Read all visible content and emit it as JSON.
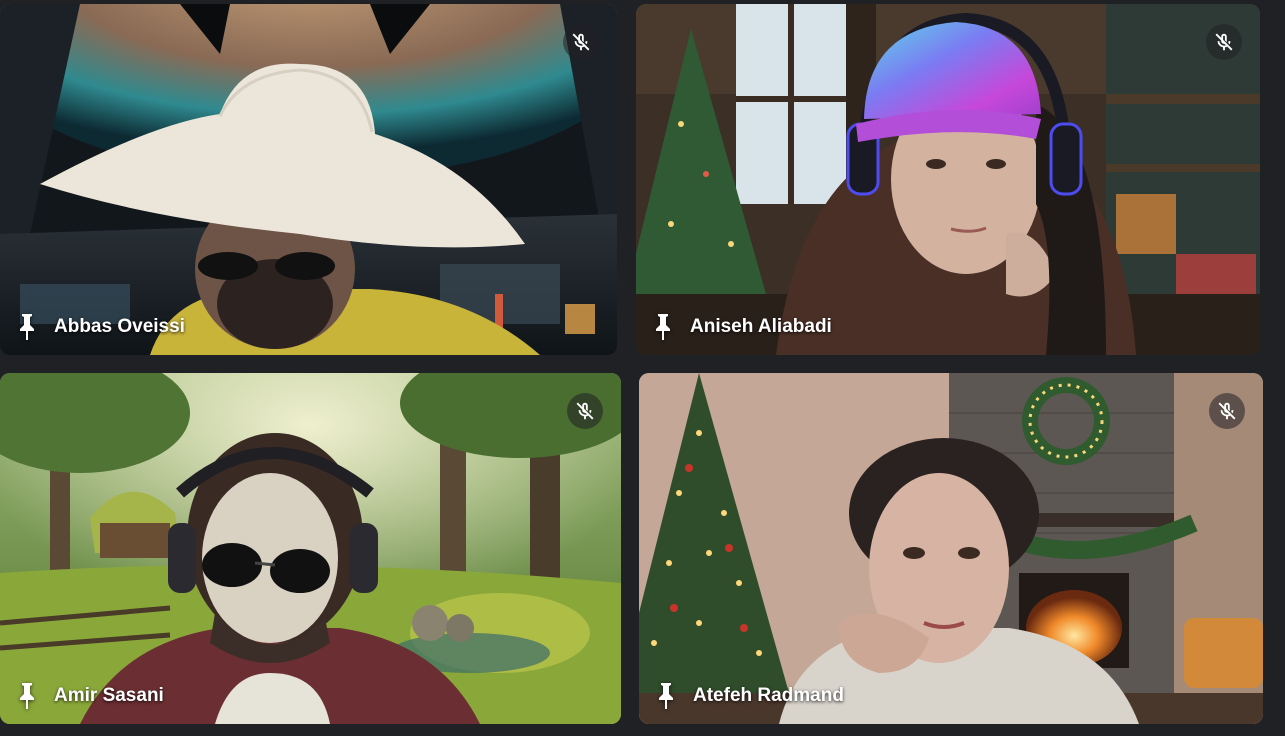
{
  "participants": [
    {
      "name": "Abbas Oveissi",
      "muted": true,
      "status_icon": "mic-off-icon",
      "pin_icon": "pin-icon"
    },
    {
      "name": "Aniseh Aliabadi",
      "muted": true,
      "status_icon": "mic-off-icon",
      "pin_icon": "pin-icon"
    },
    {
      "name": "Amir Sasani",
      "muted": true,
      "status_icon": "mic-off-icon",
      "pin_icon": "pin-icon"
    },
    {
      "name": "Atefeh Radmand",
      "muted": true,
      "status_icon": "mic-off-icon",
      "pin_icon": "pin-icon"
    }
  ],
  "colors": {
    "background": "#202124",
    "name_text": "#ffffff",
    "mute_badge": "#3c4043"
  }
}
